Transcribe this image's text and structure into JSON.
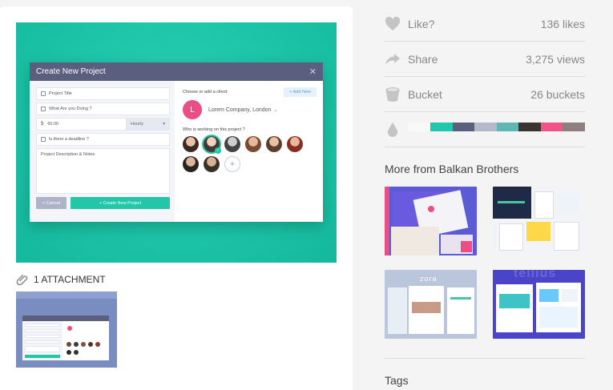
{
  "shot": {
    "modal_title": "Create New Project",
    "fields": {
      "project_title": "Project Title",
      "what_doing": "What Are you Doing ?",
      "amount": "60.00",
      "currency": "$",
      "rate": "Hourly",
      "deadline": "Is there a deadline ?",
      "notes": "Project Description & Notes"
    },
    "cancel": "Cancel",
    "create": "+ Create New Project",
    "choose_client": "Choose or add a client:",
    "add_new": "+ Add New",
    "client_initial": "L",
    "client_name": "Lorem Company, London",
    "who_working": "Who is working on this project ?"
  },
  "attachment": {
    "label": "1 ATTACHMENT"
  },
  "stats": [
    {
      "label": "Like?",
      "value": "136 likes",
      "icon": "heart-icon"
    },
    {
      "label": "Share",
      "value": "3,275 views",
      "icon": "share-arrow-icon"
    },
    {
      "label": "Bucket",
      "value": "26 buckets",
      "icon": "bucket-icon"
    }
  ],
  "palette": [
    "#f8f8f8",
    "#1ec8ae",
    "#5a5f7e",
    "#b4b8c8",
    "#5fb6b2",
    "#3a3330",
    "#f0558a",
    "#8e7e7e"
  ],
  "more_from": {
    "title": "More from Balkan Brothers"
  },
  "tags": {
    "title": "Tags"
  },
  "colors": {
    "teal": "#1ec6aa",
    "pink": "#ed4d85",
    "header": "#5a5f80"
  }
}
